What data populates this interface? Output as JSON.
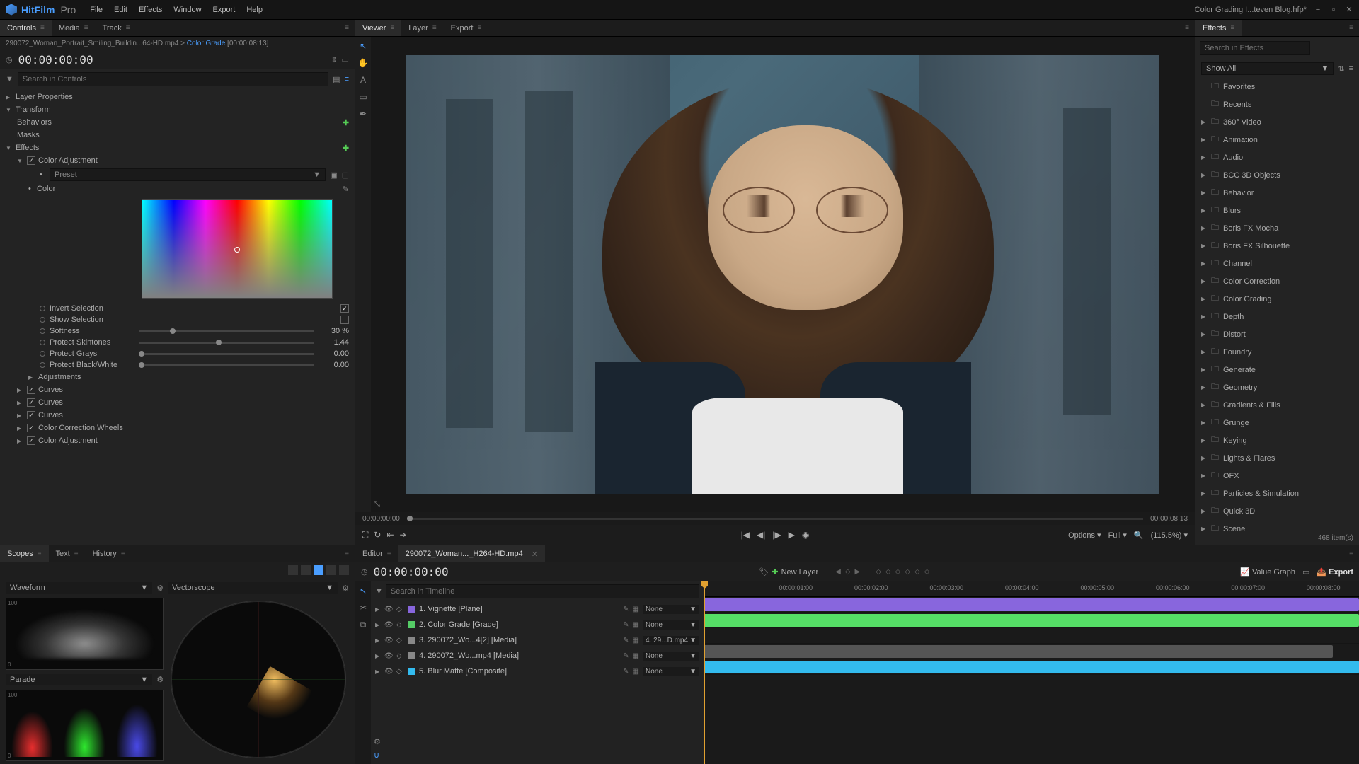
{
  "app": {
    "name": "HitFilm",
    "suffix": "Pro",
    "project": "Color Grading I...teven Blog.hfp*"
  },
  "menu": [
    "File",
    "Edit",
    "Effects",
    "Window",
    "Export",
    "Help"
  ],
  "left_tabs": [
    "Controls",
    "Media",
    "Track"
  ],
  "breadcrumb": {
    "file": "290072_Woman_Portrait_Smiling_Buildin...64-HD.mp4",
    "node": "Color Grade",
    "range": "[00:00:08:13]"
  },
  "timecode": "00:00:00:00",
  "search_controls_ph": "Search in Controls",
  "tree": {
    "layer_props": "Layer Properties",
    "transform": "Transform",
    "behaviors": "Behaviors",
    "masks": "Masks",
    "effects": "Effects",
    "color_adj": "Color Adjustment",
    "preset": "Preset",
    "color": "Color",
    "adjustments": "Adjustments",
    "curves": "Curves",
    "ccw": "Color Correction Wheels",
    "color_adj2": "Color Adjustment"
  },
  "params": {
    "invert": {
      "label": "Invert Selection",
      "checked": true
    },
    "show": {
      "label": "Show Selection",
      "checked": false
    },
    "softness": {
      "label": "Softness",
      "value": "30 %",
      "pos": 18
    },
    "skin": {
      "label": "Protect Skintones",
      "value": "1.44",
      "pos": 44
    },
    "grays": {
      "label": "Protect Grays",
      "value": "0.00",
      "pos": 0
    },
    "bw": {
      "label": "Protect Black/White",
      "value": "0.00",
      "pos": 0
    }
  },
  "viewer_tabs": [
    "Viewer",
    "Layer",
    "Export"
  ],
  "viewer": {
    "tc_left": "00:00:00:00",
    "tc_right": "00:00:08:13",
    "options": "Options",
    "full": "Full",
    "zoom": "(115.5%)"
  },
  "effects": {
    "title": "Effects",
    "search_ph": "Search in Effects",
    "filter": "Show All",
    "items": [
      "Favorites",
      "Recents",
      "360° Video",
      "Animation",
      "Audio",
      "BCC 3D Objects",
      "Behavior",
      "Blurs",
      "Boris FX Mocha",
      "Boris FX Silhouette",
      "Channel",
      "Color Correction",
      "Color Grading",
      "Depth",
      "Distort",
      "Foundry",
      "Generate",
      "Geometry",
      "Gradients & Fills",
      "Grunge",
      "Keying",
      "Lights & Flares",
      "OFX",
      "Particles & Simulation",
      "Quick 3D",
      "Scene"
    ],
    "count": "468 item(s)"
  },
  "scopes": {
    "tabs": [
      "Scopes",
      "Text",
      "History"
    ],
    "waveform": "Waveform",
    "parade": "Parade",
    "vector": "Vectorscope"
  },
  "timeline": {
    "tabs": {
      "editor": "Editor",
      "file": "290072_Woman..._H264-HD.mp4"
    },
    "tc": "00:00:00:00",
    "new_layer": "New Layer",
    "value_graph": "Value Graph",
    "export": "Export",
    "search_ph": "Search in Timeline",
    "ruler": [
      "00:00:01:00",
      "00:00:02:00",
      "00:00:03:00",
      "00:00:04:00",
      "00:00:05:00",
      "00:00:06:00",
      "00:00:07:00",
      "00:00:08:00"
    ],
    "layers": [
      {
        "name": "1. Vignette [Plane]",
        "blend": "None",
        "color": "#8866dd",
        "clip_color": "#8866dd",
        "clip_w": 100
      },
      {
        "name": "2. Color Grade [Grade]",
        "blend": "None",
        "color": "#55cc66",
        "clip_color": "#55dd66",
        "clip_w": 100
      },
      {
        "name": "3. 290072_Wo...4[2] [Media]",
        "blend": "4. 29...D.mp4",
        "color": "#888",
        "clip_color": "",
        "clip_w": 0
      },
      {
        "name": "4. 290072_Wo...mp4 [Media]",
        "blend": "None",
        "color": "#888",
        "clip_color": "#555",
        "clip_w": 96
      },
      {
        "name": "5. Blur Matte [Composite]",
        "blend": "None",
        "color": "#33bbee",
        "clip_color": "#33bbee",
        "clip_w": 100
      }
    ]
  }
}
